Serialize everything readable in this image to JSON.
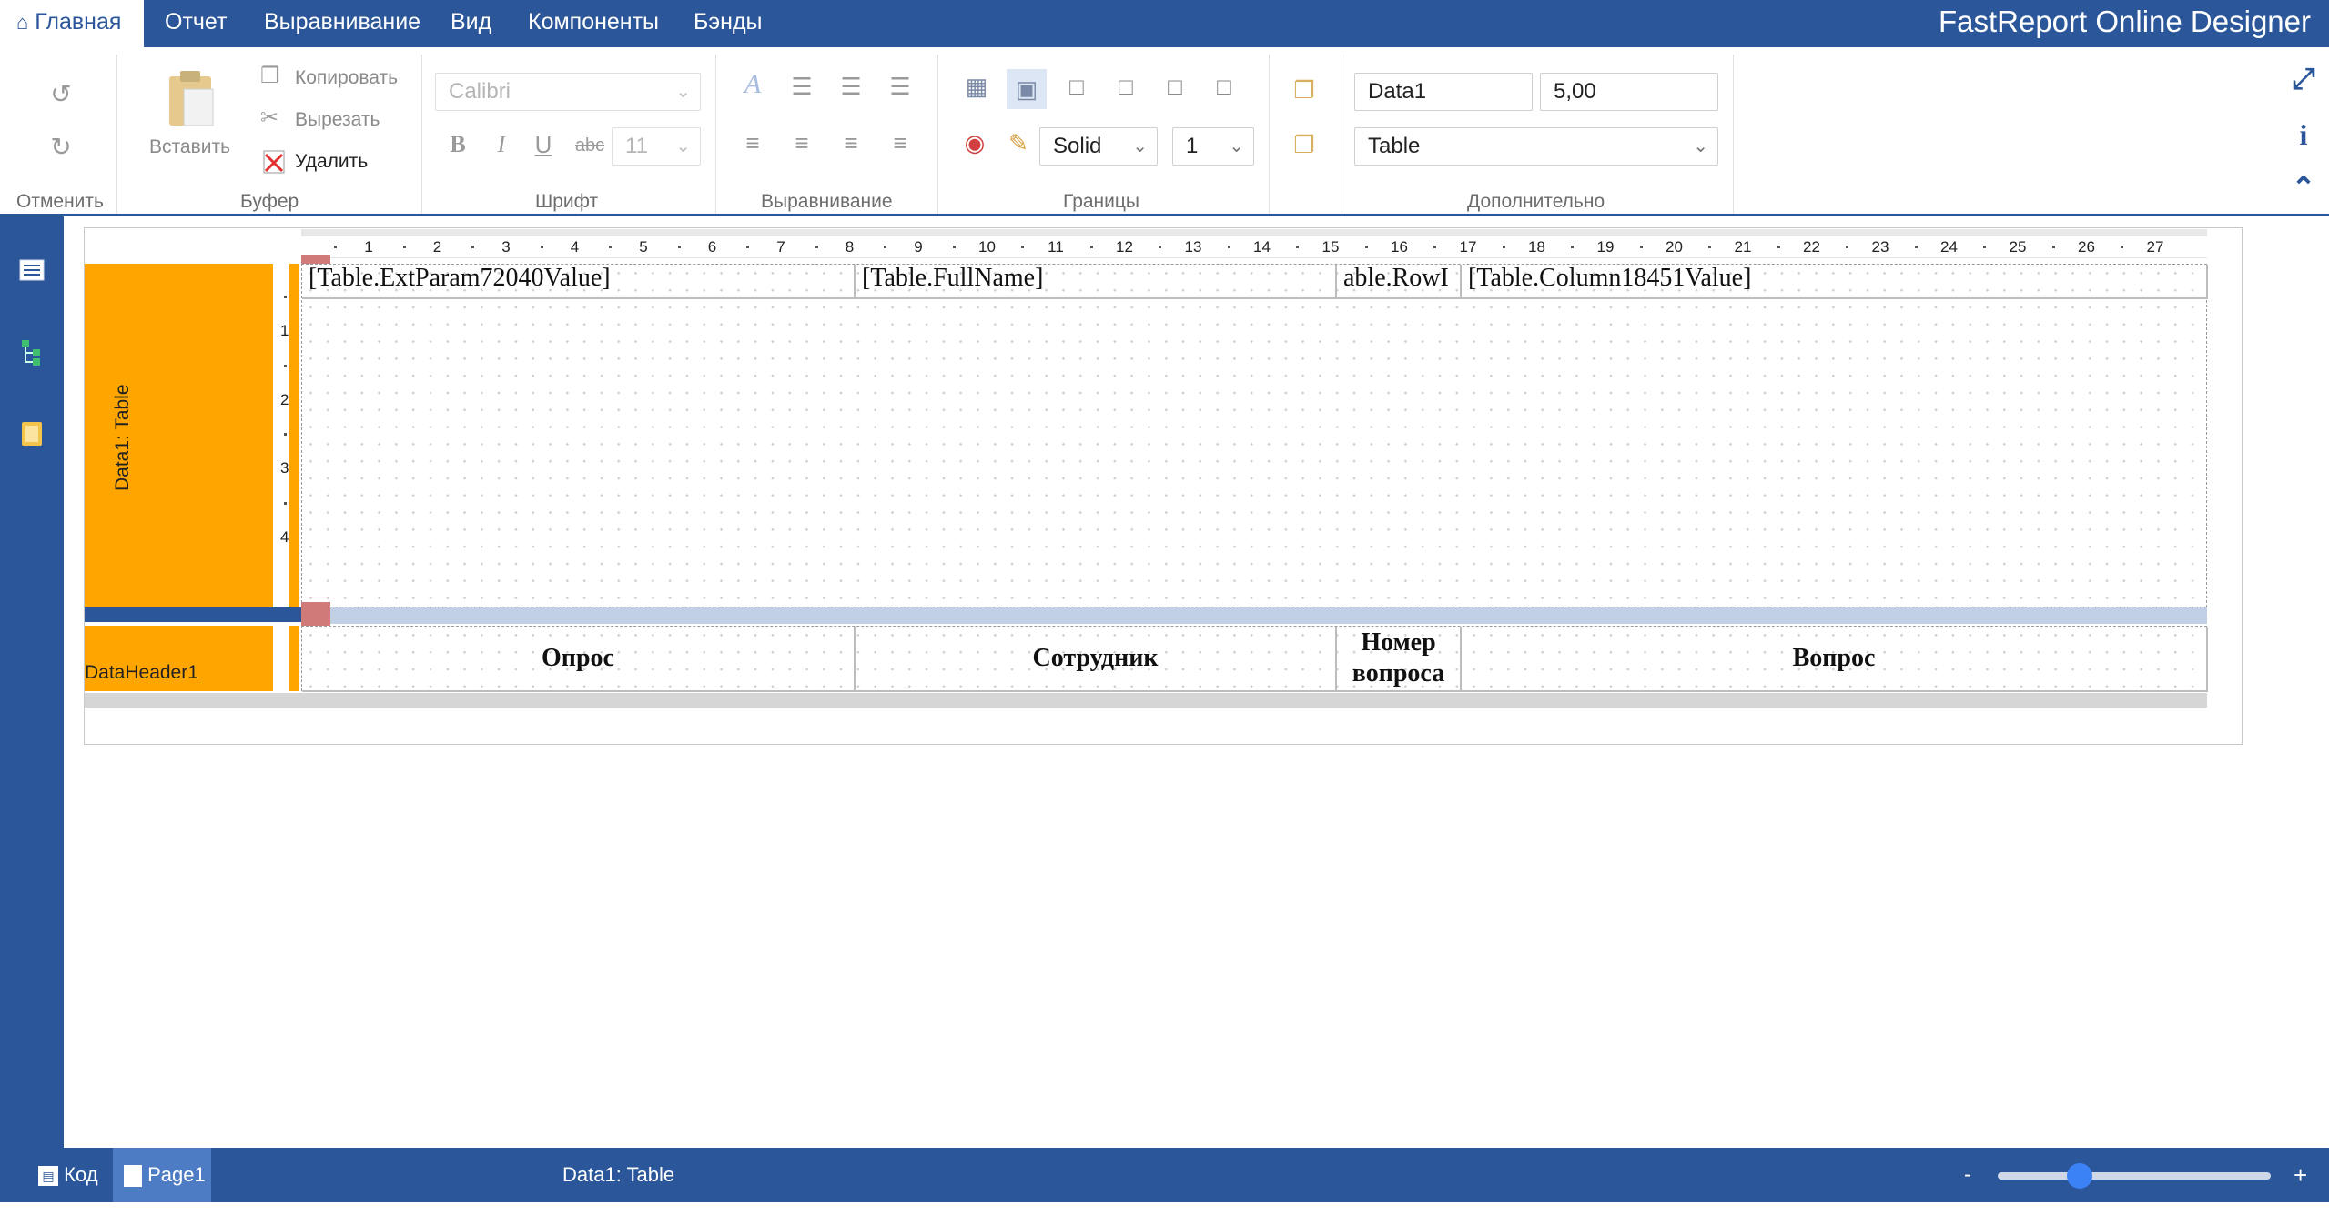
{
  "app": {
    "brand": "FastReport Online Designer"
  },
  "menu": {
    "tabs": [
      {
        "label": "Главная",
        "active": true
      },
      {
        "label": "Отчет"
      },
      {
        "label": "Выравнивание"
      },
      {
        "label": "Вид"
      },
      {
        "label": "Компоненты"
      },
      {
        "label": "Бэнды"
      }
    ]
  },
  "ribbon": {
    "undo_group": {
      "label": "Отменить"
    },
    "clipboard": {
      "label": "Буфер",
      "paste": "Вставить",
      "copy": "Копировать",
      "cut": "Вырезать",
      "delete": "Удалить"
    },
    "font": {
      "label": "Шрифт",
      "family": "Calibri",
      "size": "11",
      "bold": "B",
      "italic": "I",
      "underline": "U",
      "strike": "abc"
    },
    "alignment": {
      "label": "Выравнивание"
    },
    "borders": {
      "label": "Границы",
      "style": "Solid",
      "width": "1"
    },
    "extra": {
      "label": "Дополнительно",
      "name": "Data1",
      "height": "5,00",
      "datasource": "Table"
    }
  },
  "report": {
    "ruler_numbers": [
      "1",
      "2",
      "3",
      "4",
      "5",
      "6",
      "7",
      "8",
      "9",
      "10",
      "11",
      "12",
      "13",
      "14",
      "15",
      "16",
      "17",
      "18",
      "19",
      "20",
      "21",
      "22",
      "23",
      "24",
      "25",
      "26",
      "27"
    ],
    "vruler_numbers": [
      "1",
      "2",
      "3",
      "4"
    ],
    "data_band": {
      "label": "Data1: Table",
      "cells": [
        "[Table.ExtParam72040Value]",
        "[Table.FullName]",
        "able.RowI",
        "[Table.Column18451Value]"
      ]
    },
    "header_band": {
      "label": "DataHeader1",
      "cells": [
        "Опрос",
        "Сотрудник",
        "Номер вопроса",
        "Вопрос"
      ]
    }
  },
  "statusbar": {
    "tabs": [
      {
        "label": "Код"
      },
      {
        "label": "Page1",
        "active": true
      }
    ],
    "selection": "Data1: Table",
    "zoom_minus": "-",
    "zoom_plus": "+",
    "zoom_level": 0.3
  },
  "colors": {
    "primary": "#2b579a",
    "band": "#ffa500"
  }
}
